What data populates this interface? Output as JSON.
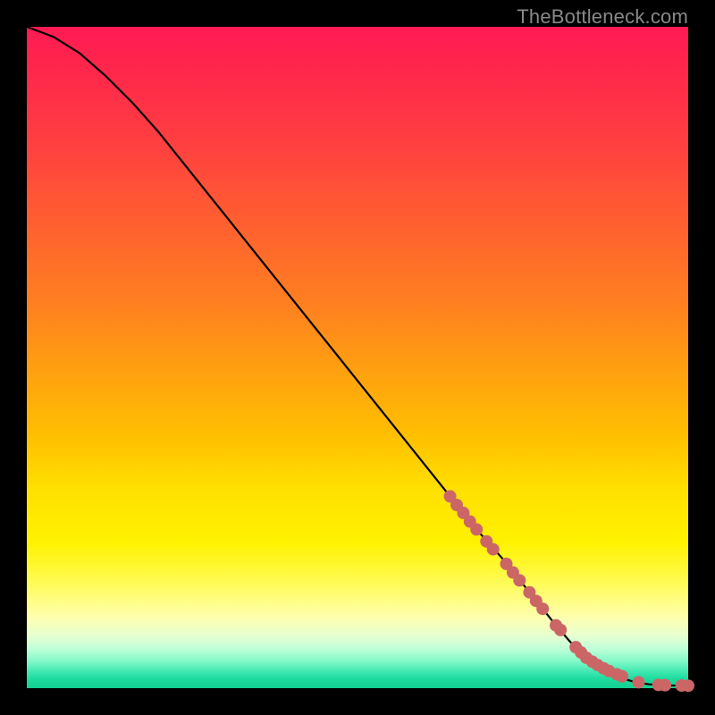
{
  "watermark": "TheBottleneck.com",
  "chart_data": {
    "type": "line",
    "title": "",
    "xlabel": "",
    "ylabel": "",
    "xlim": [
      0,
      100
    ],
    "ylim": [
      0,
      100
    ],
    "series": [
      {
        "name": "curve",
        "x": [
          0,
          4,
          8,
          12,
          16,
          20,
          24,
          28,
          32,
          36,
          40,
          44,
          48,
          52,
          56,
          60,
          64,
          68,
          72,
          76,
          80,
          82,
          84,
          86,
          88,
          90,
          92,
          94,
          96,
          98,
          100
        ],
        "y": [
          100,
          98.5,
          96.0,
          92.5,
          88.5,
          84.0,
          79.0,
          74.0,
          69.0,
          64.0,
          59.0,
          54.0,
          49.0,
          44.0,
          39.0,
          34.0,
          29.0,
          24.0,
          19.5,
          14.5,
          9.5,
          7.2,
          5.0,
          3.5,
          2.3,
          1.5,
          0.9,
          0.6,
          0.45,
          0.4,
          0.38
        ]
      }
    ],
    "markers": {
      "name": "points",
      "color": "#cc6666",
      "x": [
        64,
        65,
        66,
        67,
        68,
        69.5,
        70.5,
        72.5,
        73.5,
        74.5,
        76,
        77,
        78,
        80,
        80.7,
        83,
        83.8,
        84.6,
        85.5,
        86.3,
        87.2,
        88,
        89.2,
        90,
        92.5,
        95.5,
        96.5,
        99,
        100
      ],
      "y": [
        29.0,
        27.7,
        26.5,
        25.2,
        24.0,
        22.2,
        21.0,
        18.8,
        17.5,
        16.3,
        14.5,
        13.2,
        12.0,
        9.5,
        8.8,
        6.2,
        5.4,
        4.6,
        4.0,
        3.5,
        3.0,
        2.6,
        2.1,
        1.8,
        0.9,
        0.5,
        0.45,
        0.4,
        0.38
      ]
    }
  }
}
